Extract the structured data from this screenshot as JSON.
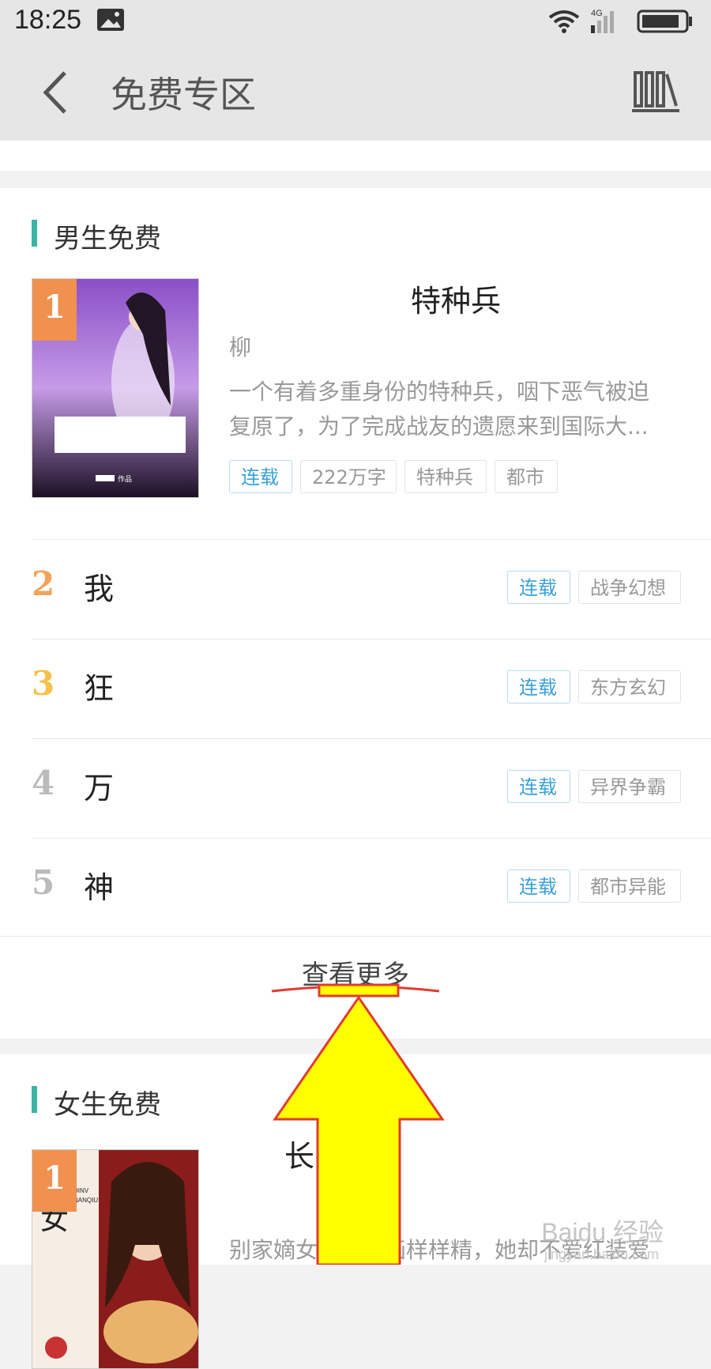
{
  "status_bar": {
    "time": "18:25",
    "network": "4G",
    "icons": [
      "image-icon",
      "wifi-icon",
      "signal-icon",
      "battery-icon"
    ]
  },
  "header": {
    "title": "免费专区",
    "back_icon": "back-icon",
    "shelf_icon": "bookshelf-icon"
  },
  "male_section": {
    "title": "男生免费",
    "featured": {
      "rank": "1",
      "title": "特种兵",
      "author": "柳",
      "desc_line1": "一个有着多重身份的特种兵，咽下恶气被迫",
      "desc_line2": "复原了，为了完成战友的遗愿来到国际大...",
      "tags": [
        "连载",
        "222万字",
        "特种兵",
        "都市"
      ],
      "cover_caption": "作品"
    },
    "list": [
      {
        "rank": "2",
        "title": "我",
        "status": "连载",
        "genre": "战争幻想"
      },
      {
        "rank": "3",
        "title": "狂",
        "status": "连载",
        "genre": "东方玄幻"
      },
      {
        "rank": "4",
        "title": "万",
        "status": "连载",
        "genre": "异界争霸"
      },
      {
        "rank": "5",
        "title": "神",
        "status": "连载",
        "genre": "都市异能"
      }
    ],
    "view_more": "查看更多"
  },
  "female_section": {
    "title": "女生免费",
    "featured": {
      "rank": "1",
      "title": "长",
      "desc_partial": "别家嫡女琴棋书画样样精，她却不爱红装爱",
      "cover_text_1": "贵",
      "cover_text_2": "女",
      "cover_text_3": "DINV",
      "cover_text_4": "NANQIU"
    }
  },
  "watermark": {
    "main": "Baidu 经验",
    "sub": "jingyan.baidu.com"
  },
  "colors": {
    "accent_teal": "#3bb4a5",
    "rank_orange": "#f0914f",
    "rank2": "#f2a35a",
    "rank3": "#f6c04a",
    "rank_gray": "#bbbbbb",
    "tag_blue": "#3aa1d8",
    "arrow_yellow": "#ffff00",
    "arrow_red": "#e23b2e"
  }
}
